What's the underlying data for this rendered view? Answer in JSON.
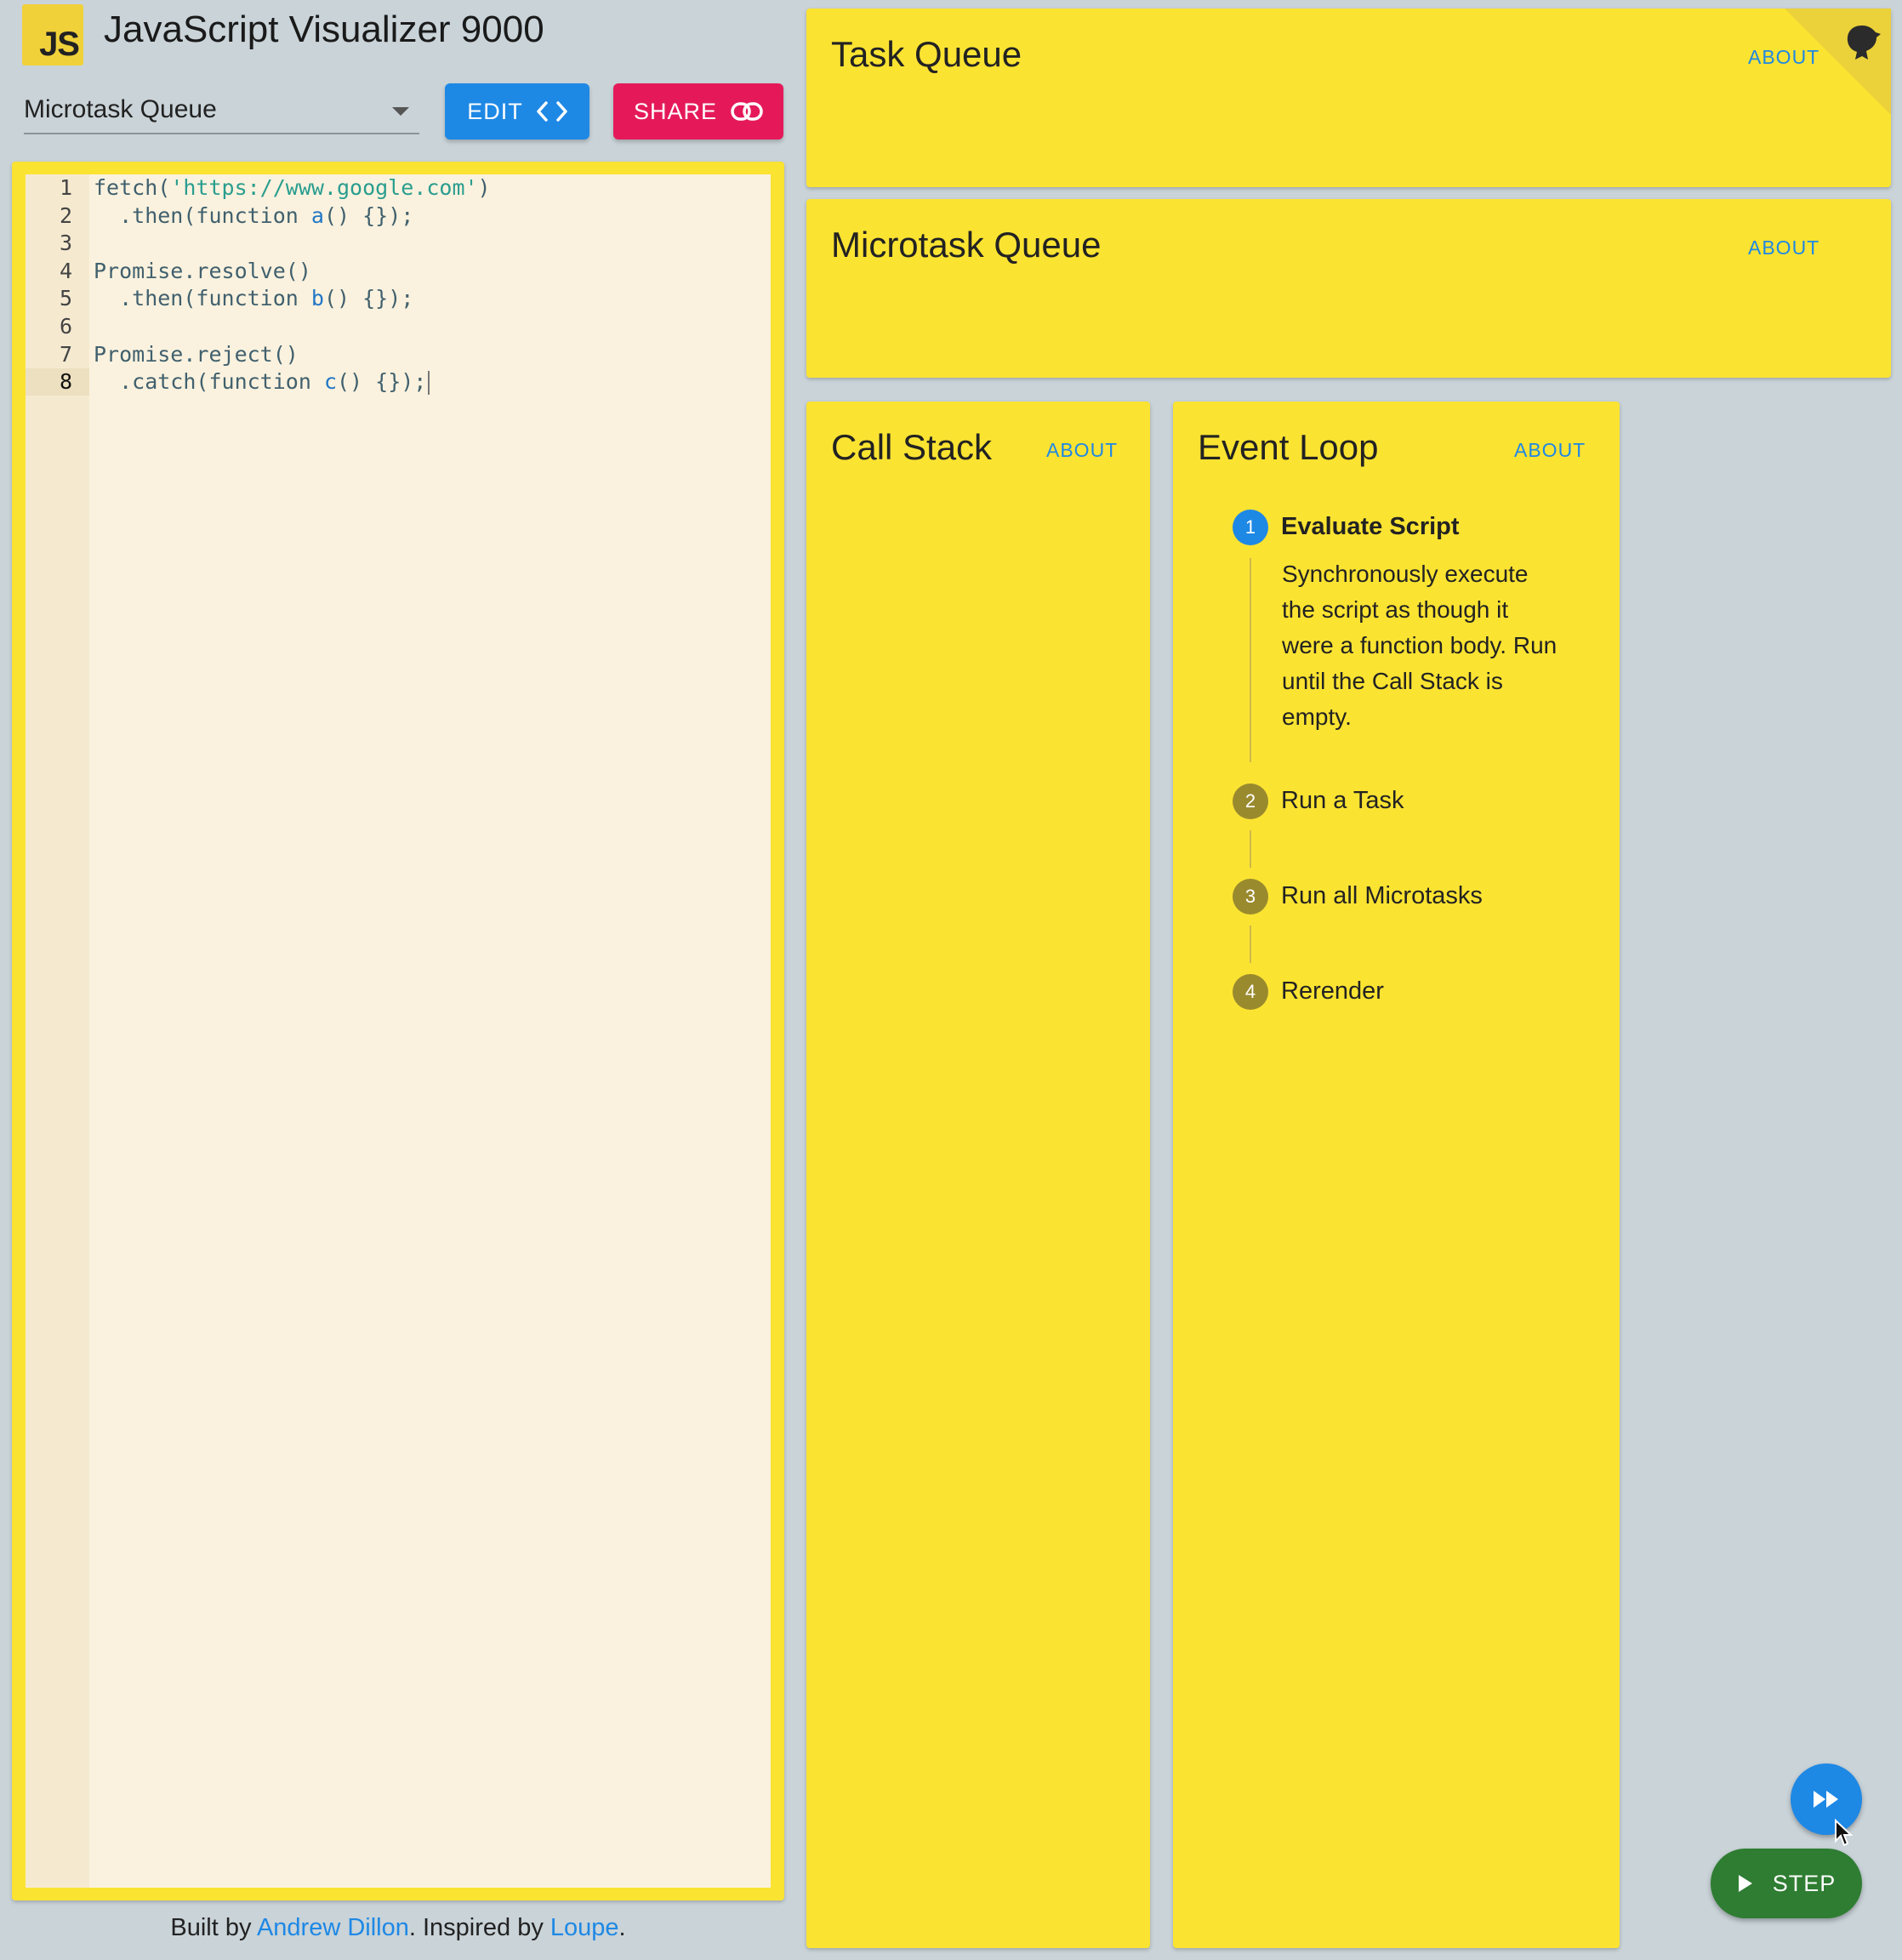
{
  "header": {
    "logo_text": "JS",
    "title": "JavaScript Visualizer 9000"
  },
  "toolbar": {
    "example_select": "Microtask Queue",
    "edit_label": "EDIT",
    "share_label": "SHARE"
  },
  "editor": {
    "lines": [
      {
        "num": "1",
        "segments": [
          {
            "t": "fetch(",
            "k": ""
          },
          {
            "t": "'https://www.google.com'",
            "k": "str"
          },
          {
            "t": ")",
            "k": ""
          }
        ]
      },
      {
        "num": "2",
        "segments": [
          {
            "t": "  .then(function ",
            "k": ""
          },
          {
            "t": "a",
            "k": "fn"
          },
          {
            "t": "() {});",
            "k": ""
          }
        ]
      },
      {
        "num": "3",
        "segments": []
      },
      {
        "num": "4",
        "segments": [
          {
            "t": "Promise.resolve()",
            "k": ""
          }
        ]
      },
      {
        "num": "5",
        "segments": [
          {
            "t": "  .then(function ",
            "k": ""
          },
          {
            "t": "b",
            "k": "fn"
          },
          {
            "t": "() {});",
            "k": ""
          }
        ]
      },
      {
        "num": "6",
        "segments": []
      },
      {
        "num": "7",
        "segments": [
          {
            "t": "Promise.reject()",
            "k": ""
          }
        ]
      },
      {
        "num": "8",
        "segments": [
          {
            "t": "  .catch(function ",
            "k": ""
          },
          {
            "t": "c",
            "k": "fn"
          },
          {
            "t": "() {});",
            "k": ""
          }
        ],
        "active": true
      }
    ]
  },
  "footer": {
    "prefix": "Built by ",
    "author": "Andrew Dillon",
    "middle": ". Inspired by ",
    "inspiration": "Loupe",
    "suffix": "."
  },
  "panels": {
    "task_queue": {
      "title": "Task Queue",
      "about": "ABOUT"
    },
    "microtask_queue": {
      "title": "Microtask Queue",
      "about": "ABOUT"
    },
    "call_stack": {
      "title": "Call Stack",
      "about": "ABOUT"
    },
    "event_loop": {
      "title": "Event Loop",
      "about": "ABOUT",
      "steps": [
        {
          "num": "1",
          "label": "Evaluate Script",
          "active": true,
          "desc": "Synchronously execute the script as though it were a function body. Run until the Call Stack is empty."
        },
        {
          "num": "2",
          "label": "Run a Task",
          "active": false
        },
        {
          "num": "3",
          "label": "Run all Microtasks",
          "active": false
        },
        {
          "num": "4",
          "label": "Rerender",
          "active": false
        }
      ]
    }
  },
  "controls": {
    "step_label": "STEP"
  },
  "colors": {
    "panel": "#fbe332",
    "accent_blue": "#1e88e5",
    "share_pink": "#e5195a",
    "step_green": "#2e7d32",
    "background": "#c9d3d8"
  }
}
